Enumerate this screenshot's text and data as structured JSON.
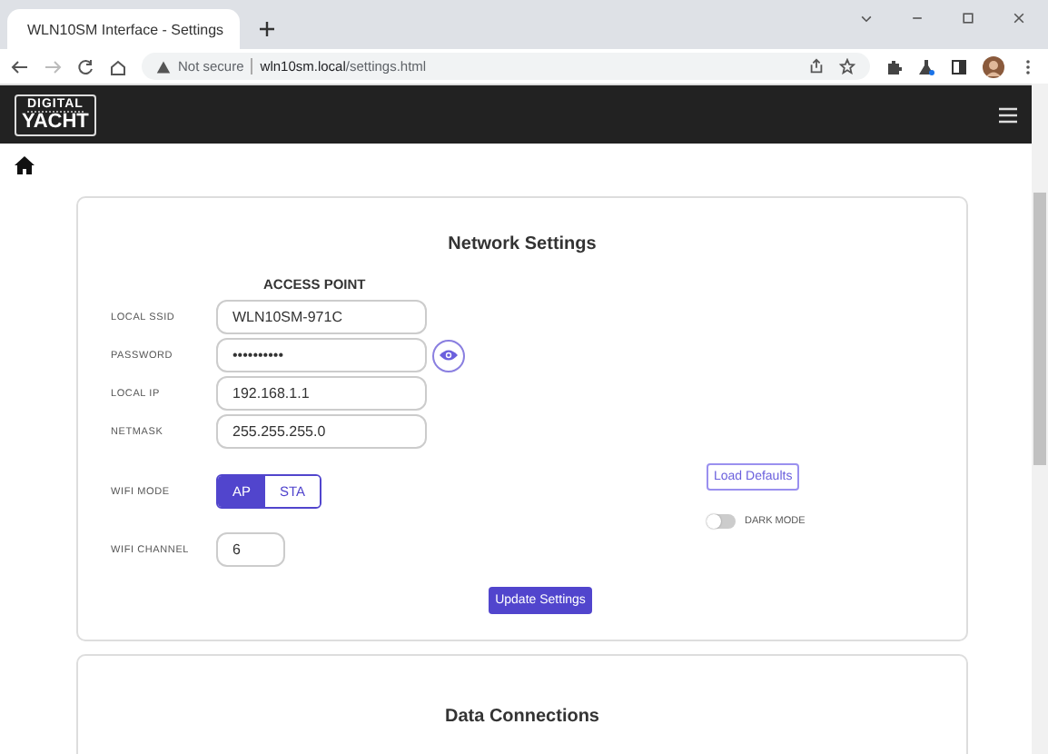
{
  "browser": {
    "tab_title": "WLN10SM Interface - Settings",
    "security": "Not secure",
    "host": "wln10sm.local",
    "path": "/settings.html"
  },
  "header": {
    "logo_top": "DIGITAL",
    "logo_bottom": "YACHT"
  },
  "network_settings": {
    "title": "Network Settings",
    "section": "ACCESS POINT",
    "fields": [
      {
        "label": "LOCAL SSID",
        "value": "WLN10SM-971C",
        "kind": "text"
      },
      {
        "label": "PASSWORD",
        "value": "••••••••••",
        "kind": "password"
      },
      {
        "label": "LOCAL IP",
        "value": "192.168.1.1",
        "kind": "text"
      },
      {
        "label": "NETMASK",
        "value": "255.255.255.0",
        "kind": "text"
      }
    ],
    "wifi_mode": {
      "label": "WIFI MODE",
      "options": [
        {
          "label": "AP",
          "selected": true
        },
        {
          "label": "STA",
          "selected": false
        }
      ]
    },
    "wifi_channel": {
      "label": "WIFI CHANNEL",
      "value": "6"
    },
    "load_defaults": "Load Defaults",
    "dark_mode": {
      "label": "DARK MODE",
      "on": false
    },
    "update_button": "Update Settings"
  },
  "data_connections": {
    "title": "Data Connections"
  }
}
